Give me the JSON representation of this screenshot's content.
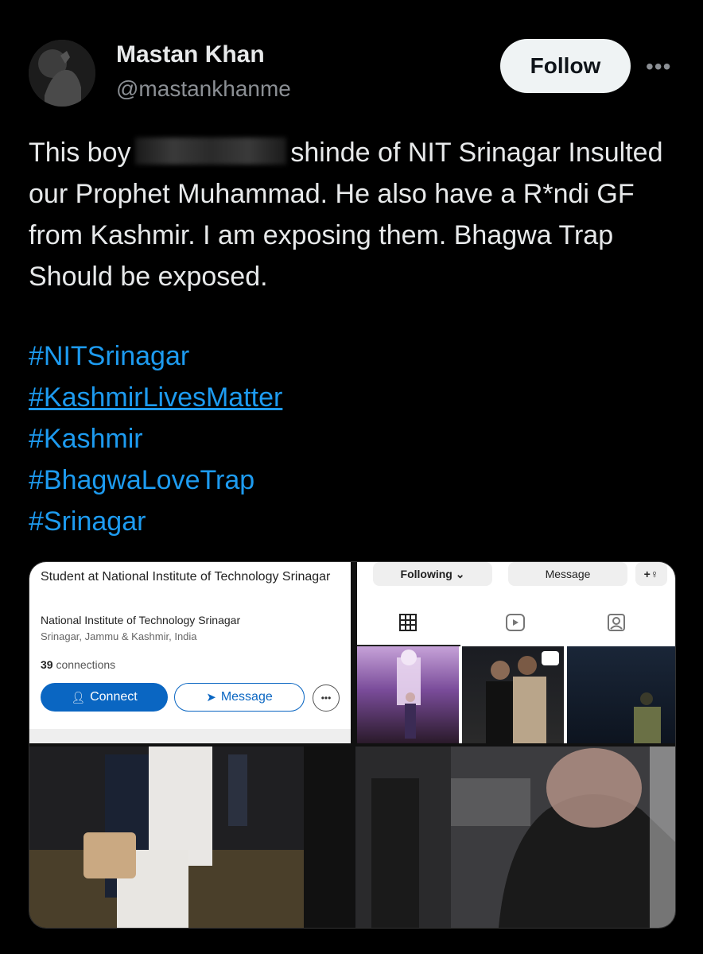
{
  "author": {
    "name": "Mastan Khan",
    "handle": "@mastankhanme",
    "avatar_icon": "avatar-icon"
  },
  "follow_label": "Follow",
  "more_label": "•••",
  "tweet": {
    "text_part1": "This boy ",
    "text_part2": " shinde of NIT Srinagar Insulted our Prophet Muhammad. He also have a R*ndi GF from Kashmir. I am exposing them. Bhagwa Trap Should be exposed.",
    "hashtags": [
      "#NITSrinagar",
      "#KashmirLivesMatter",
      "#Kashmir",
      "#BhagwaLoveTrap",
      "#Srinagar"
    ]
  },
  "media": {
    "linkedin": {
      "title": "Student at National Institute of Technology Srinagar",
      "org": "National Institute of Technology Srinagar",
      "location": "Srinagar, Jammu & Kashmir, India",
      "connections_count": "39",
      "connections_label": "connections",
      "connect_label": "Connect",
      "message_label": "Message"
    },
    "instagram": {
      "following_label": "Following ⌄",
      "message_label": "Message",
      "add_person_icon": "add-person-icon",
      "tabs": [
        "grid-icon",
        "reels-icon",
        "tagged-icon"
      ]
    }
  },
  "colors": {
    "background": "#000000",
    "text": "#e7e9ea",
    "muted": "#8b8f94",
    "link": "#1d9bf0",
    "linkedin_blue": "#0a66c2"
  }
}
